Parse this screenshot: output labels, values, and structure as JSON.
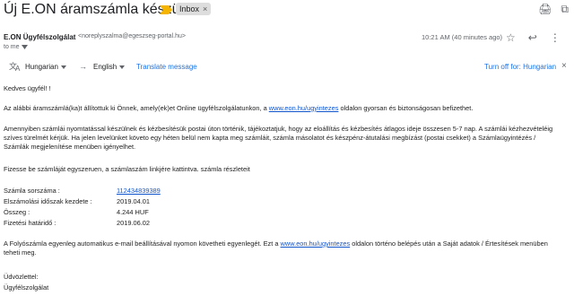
{
  "header": {
    "subject": "Új E.ON áramszámla készült",
    "label": "Inbox",
    "label_close": "×"
  },
  "top_icons": {
    "print": "🖨",
    "open_new": "⧉"
  },
  "sender": {
    "name": "E.ON Ügyfélszolgálat",
    "email": "<noreplyszalma@egeszseg-portal.hu>",
    "to": "to me",
    "time": "10:21 AM (40 minutes ago)"
  },
  "header_icons": {
    "star": "☆",
    "reply": "↩",
    "more": "⋮"
  },
  "translate_bar": {
    "from_lang": "Hungarian",
    "arrow": "→",
    "to_lang": "English",
    "translate_label": "Translate message",
    "turn_off": "Turn off for: Hungarian",
    "close": "×"
  },
  "message": {
    "greeting": "Kedves ügyfél! !",
    "p1_before": "Az alábbi áramszámlá(ka)t állítottuk ki Önnek, amely(ek)et Online ügyfélszolgálatunkon, a ",
    "p1_link": "www.eon.hu/ugyintezes",
    "p1_after": " oldalon gyorsan és biztonságosan befizethet.",
    "p2": "Amennyiben számlái nyomtatással készülnek és kézbesítésük postai úton történik, tájékoztatjuk, hogy az eloállítás és kézbesítés átlagos ideje összesen 5-7 nap. A számlái kézhezvételéig szíves türelmét kérjük. Ha jelen levelünket követo egy héten belül nem kapta meg számláit, számla másolatot és készpénz-átutalási megbízást (postai csekket) a Számlaügyintézés / Számlák megjelenítése menüben igényelhet.",
    "p3": "Fizesse be számláját egyszeruen, a számlaszám linkjére kattintva. számla részleteit",
    "details": [
      {
        "label": "Számla sorszáma :",
        "value": "112434839389",
        "link": true
      },
      {
        "label": "Elszámolási időszak kezdete :",
        "value": "2019.04.01",
        "link": false
      },
      {
        "label": "Összeg :",
        "value": "4.244 HUF",
        "link": false
      },
      {
        "label": "Fizetési határidő :",
        "value": "2019.06.02",
        "link": false
      }
    ],
    "p4_before": "A Folyószámla egyenleg automatikus e-mail beállításával nyomon követheti egyenlegét. Ezt a ",
    "p4_link": "www.eon.hu/ugyintezes",
    "p4_after": " oldalon történo belépés után a Saját adatok / Értesítések menüben teheti meg.",
    "closing1": "Üdvözlettel:",
    "closing2": "Ügyfélszolgálat"
  }
}
